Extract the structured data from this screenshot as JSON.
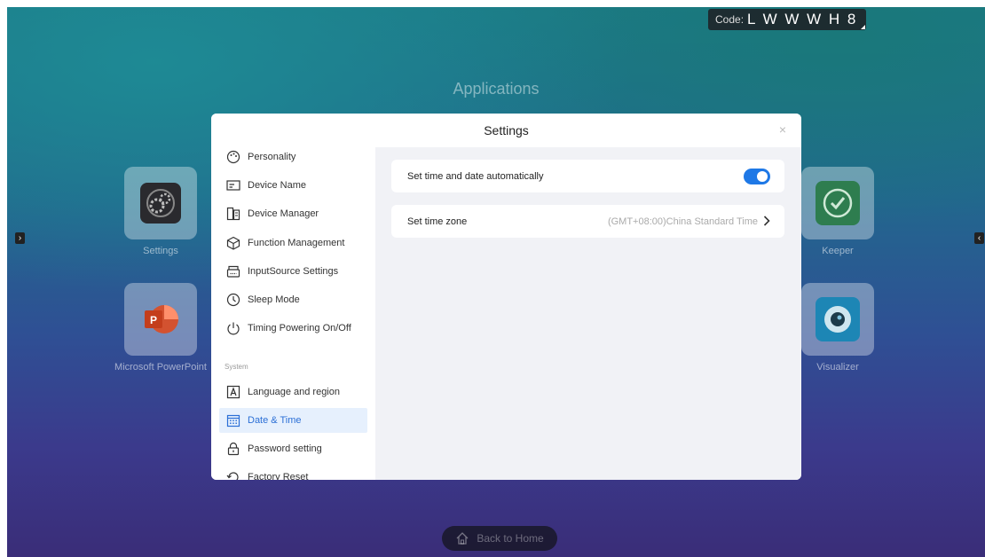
{
  "code_badge": {
    "label": "Code:",
    "value": "L W W W H 8"
  },
  "desktop": {
    "title": "Applications",
    "apps": [
      {
        "label": "Settings",
        "icon": "settings-gear-icon"
      },
      {
        "label": "Microsoft PowerPoint",
        "icon": "powerpoint-icon"
      },
      {
        "label": "Keeper",
        "icon": "keeper-check-icon"
      },
      {
        "label": "Visualizer",
        "icon": "visualizer-camera-icon"
      }
    ],
    "left_arrow": "›",
    "right_arrow": "‹",
    "home_button": "Back to Home"
  },
  "settings": {
    "title": "Settings",
    "close": "×",
    "nav": [
      {
        "label": "Personality",
        "icon": "palette-icon"
      },
      {
        "label": "Device Name",
        "icon": "device-name-icon"
      },
      {
        "label": "Device Manager",
        "icon": "device-manager-icon"
      },
      {
        "label": "Function Management",
        "icon": "cube-icon"
      },
      {
        "label": "InputSource Settings",
        "icon": "input-source-icon"
      },
      {
        "label": "Sleep Mode",
        "icon": "clock-icon"
      },
      {
        "label": "Timing Powering On/Off",
        "icon": "power-icon"
      }
    ],
    "system_section": "System",
    "system_nav": [
      {
        "label": "Language and region",
        "icon": "language-icon"
      },
      {
        "label": "Date & Time",
        "icon": "calendar-icon",
        "active": true
      },
      {
        "label": "Password setting",
        "icon": "lock-icon"
      },
      {
        "label": "Factory Reset",
        "icon": "reset-icon"
      }
    ],
    "rows": {
      "auto_time": {
        "label": "Set time and date automatically",
        "enabled": true
      },
      "time_zone": {
        "label": "Set time zone",
        "value": "(GMT+08:00)China Standard Time"
      }
    }
  },
  "colors": {
    "accent": "#1e78e6",
    "active_bg": "#e6f0fd"
  }
}
